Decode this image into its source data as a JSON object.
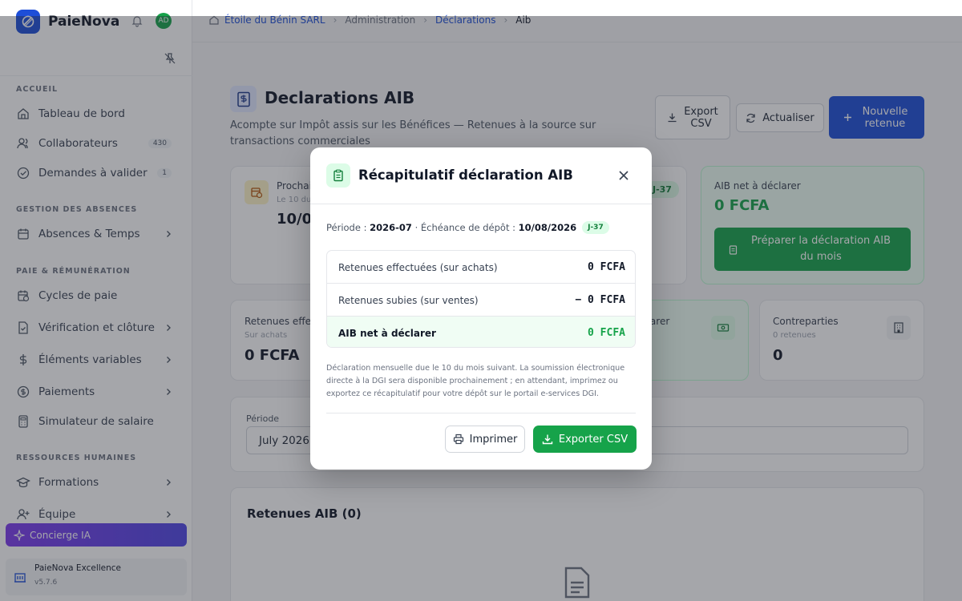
{
  "app": {
    "brand_name": "PaieNova",
    "user_initials": "AD",
    "accent_color": "#1d4ed8",
    "success_color": "#16a34a"
  },
  "sidebar": {
    "sections": [
      {
        "title": "ACCUEIL",
        "items": [
          {
            "label": "Tableau de bord",
            "icon": "home-icon"
          },
          {
            "label": "Collaborateurs",
            "icon": "users-icon",
            "badge": "430"
          },
          {
            "label": "Demandes à valider",
            "icon": "check-circle-icon",
            "badge": "1"
          }
        ]
      },
      {
        "title": "GESTION DES ABSENCES",
        "items": [
          {
            "label": "Absences & Temps",
            "icon": "calendar-icon",
            "has_submenu": true
          }
        ]
      },
      {
        "title": "PAIE & RÉMUNÉRATION",
        "items": [
          {
            "label": "Cycles de paie",
            "icon": "calendar-clock-icon"
          },
          {
            "label": "Vérification et clôture",
            "icon": "file-check-icon",
            "has_submenu": true
          },
          {
            "label": "Éléments variables",
            "icon": "dollar-icon",
            "has_submenu": true
          },
          {
            "label": "Paiements",
            "icon": "coin-icon",
            "has_submenu": true
          },
          {
            "label": "Simulateur de salaire",
            "icon": "calculator-icon"
          }
        ]
      },
      {
        "title": "RESSOURCES HUMAINES",
        "items": [
          {
            "label": "Formations",
            "icon": "graduation-icon",
            "has_submenu": true
          },
          {
            "label": "Équipe",
            "icon": "user-plus-icon",
            "has_submenu": true
          }
        ]
      }
    ],
    "concierge_label": "Concierge IA",
    "plan_name": "PaieNova Excellence",
    "version": "v5.7.6"
  },
  "breadcrumb": {
    "company": "Étoile du Bénin SARL",
    "section": "Administration",
    "subsection": "Déclarations",
    "current": "Aib"
  },
  "header": {
    "title": "Declarations AIB",
    "subtitle": "Acompte sur Impôt assis sur les Bénéfices — Retenues à la source sur transactions commerciales",
    "export_label": "Export CSV",
    "refresh_label": "Actualiser",
    "new_label": "Nouvelle retenue"
  },
  "cards_top": {
    "next_label": "Prochain",
    "next_sub": "Le 10 du",
    "next_value": "10/08",
    "countdown_chip": "J-37",
    "net_label": "AIB net à déclarer",
    "net_value": "0 FCFA",
    "prepare_label": "Préparer la déclaration AIB du mois"
  },
  "cards_bottom": {
    "retenues_label": "Retenues effect",
    "retenues_sub": "Sur achats",
    "retenues_value": "0 FCFA",
    "declarer_label": "clarer",
    "contreparties_label": "Contreparties",
    "contreparties_sub": "0 retenues",
    "contreparties_value": "0"
  },
  "filters": {
    "period_label": "Période",
    "period_value": "July 2026"
  },
  "list": {
    "title": "Retenues AIB (0)"
  },
  "modal": {
    "title": "Récapitulatif déclaration AIB",
    "period_prefix": "Période : ",
    "period": "2026-07",
    "deadline_prefix": " · Échéance de dépôt : ",
    "deadline": "10/08/2026",
    "chip": "J-37",
    "rows": [
      {
        "label": "Retenues effectuées (sur achats)",
        "value": "0 FCFA"
      },
      {
        "label": "Retenues subies (sur ventes)",
        "value": "− 0 FCFA"
      },
      {
        "label": "AIB net à déclarer",
        "value": "0 FCFA"
      }
    ],
    "note": "Déclaration mensuelle due le 10 du mois suivant. La soumission électronique directe à la DGI sera disponible prochainement ; en attendant, imprimez ou exportez ce récapitulatif pour votre dépôt sur le portail e-services DGI.",
    "print_label": "Imprimer",
    "export_label": "Exporter CSV"
  }
}
